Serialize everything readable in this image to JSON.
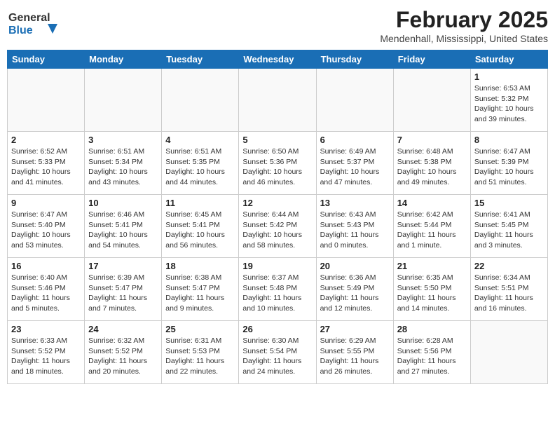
{
  "header": {
    "logo_line1": "General",
    "logo_line2": "Blue",
    "title": "February 2025",
    "subtitle": "Mendenhall, Mississippi, United States"
  },
  "weekdays": [
    "Sunday",
    "Monday",
    "Tuesday",
    "Wednesday",
    "Thursday",
    "Friday",
    "Saturday"
  ],
  "weeks": [
    [
      {
        "day": "",
        "info": ""
      },
      {
        "day": "",
        "info": ""
      },
      {
        "day": "",
        "info": ""
      },
      {
        "day": "",
        "info": ""
      },
      {
        "day": "",
        "info": ""
      },
      {
        "day": "",
        "info": ""
      },
      {
        "day": "1",
        "info": "Sunrise: 6:53 AM\nSunset: 5:32 PM\nDaylight: 10 hours and 39 minutes."
      }
    ],
    [
      {
        "day": "2",
        "info": "Sunrise: 6:52 AM\nSunset: 5:33 PM\nDaylight: 10 hours and 41 minutes."
      },
      {
        "day": "3",
        "info": "Sunrise: 6:51 AM\nSunset: 5:34 PM\nDaylight: 10 hours and 43 minutes."
      },
      {
        "day": "4",
        "info": "Sunrise: 6:51 AM\nSunset: 5:35 PM\nDaylight: 10 hours and 44 minutes."
      },
      {
        "day": "5",
        "info": "Sunrise: 6:50 AM\nSunset: 5:36 PM\nDaylight: 10 hours and 46 minutes."
      },
      {
        "day": "6",
        "info": "Sunrise: 6:49 AM\nSunset: 5:37 PM\nDaylight: 10 hours and 47 minutes."
      },
      {
        "day": "7",
        "info": "Sunrise: 6:48 AM\nSunset: 5:38 PM\nDaylight: 10 hours and 49 minutes."
      },
      {
        "day": "8",
        "info": "Sunrise: 6:47 AM\nSunset: 5:39 PM\nDaylight: 10 hours and 51 minutes."
      }
    ],
    [
      {
        "day": "9",
        "info": "Sunrise: 6:47 AM\nSunset: 5:40 PM\nDaylight: 10 hours and 53 minutes."
      },
      {
        "day": "10",
        "info": "Sunrise: 6:46 AM\nSunset: 5:41 PM\nDaylight: 10 hours and 54 minutes."
      },
      {
        "day": "11",
        "info": "Sunrise: 6:45 AM\nSunset: 5:41 PM\nDaylight: 10 hours and 56 minutes."
      },
      {
        "day": "12",
        "info": "Sunrise: 6:44 AM\nSunset: 5:42 PM\nDaylight: 10 hours and 58 minutes."
      },
      {
        "day": "13",
        "info": "Sunrise: 6:43 AM\nSunset: 5:43 PM\nDaylight: 11 hours and 0 minutes."
      },
      {
        "day": "14",
        "info": "Sunrise: 6:42 AM\nSunset: 5:44 PM\nDaylight: 11 hours and 1 minute."
      },
      {
        "day": "15",
        "info": "Sunrise: 6:41 AM\nSunset: 5:45 PM\nDaylight: 11 hours and 3 minutes."
      }
    ],
    [
      {
        "day": "16",
        "info": "Sunrise: 6:40 AM\nSunset: 5:46 PM\nDaylight: 11 hours and 5 minutes."
      },
      {
        "day": "17",
        "info": "Sunrise: 6:39 AM\nSunset: 5:47 PM\nDaylight: 11 hours and 7 minutes."
      },
      {
        "day": "18",
        "info": "Sunrise: 6:38 AM\nSunset: 5:47 PM\nDaylight: 11 hours and 9 minutes."
      },
      {
        "day": "19",
        "info": "Sunrise: 6:37 AM\nSunset: 5:48 PM\nDaylight: 11 hours and 10 minutes."
      },
      {
        "day": "20",
        "info": "Sunrise: 6:36 AM\nSunset: 5:49 PM\nDaylight: 11 hours and 12 minutes."
      },
      {
        "day": "21",
        "info": "Sunrise: 6:35 AM\nSunset: 5:50 PM\nDaylight: 11 hours and 14 minutes."
      },
      {
        "day": "22",
        "info": "Sunrise: 6:34 AM\nSunset: 5:51 PM\nDaylight: 11 hours and 16 minutes."
      }
    ],
    [
      {
        "day": "23",
        "info": "Sunrise: 6:33 AM\nSunset: 5:52 PM\nDaylight: 11 hours and 18 minutes."
      },
      {
        "day": "24",
        "info": "Sunrise: 6:32 AM\nSunset: 5:52 PM\nDaylight: 11 hours and 20 minutes."
      },
      {
        "day": "25",
        "info": "Sunrise: 6:31 AM\nSunset: 5:53 PM\nDaylight: 11 hours and 22 minutes."
      },
      {
        "day": "26",
        "info": "Sunrise: 6:30 AM\nSunset: 5:54 PM\nDaylight: 11 hours and 24 minutes."
      },
      {
        "day": "27",
        "info": "Sunrise: 6:29 AM\nSunset: 5:55 PM\nDaylight: 11 hours and 26 minutes."
      },
      {
        "day": "28",
        "info": "Sunrise: 6:28 AM\nSunset: 5:56 PM\nDaylight: 11 hours and 27 minutes."
      },
      {
        "day": "",
        "info": ""
      }
    ]
  ]
}
